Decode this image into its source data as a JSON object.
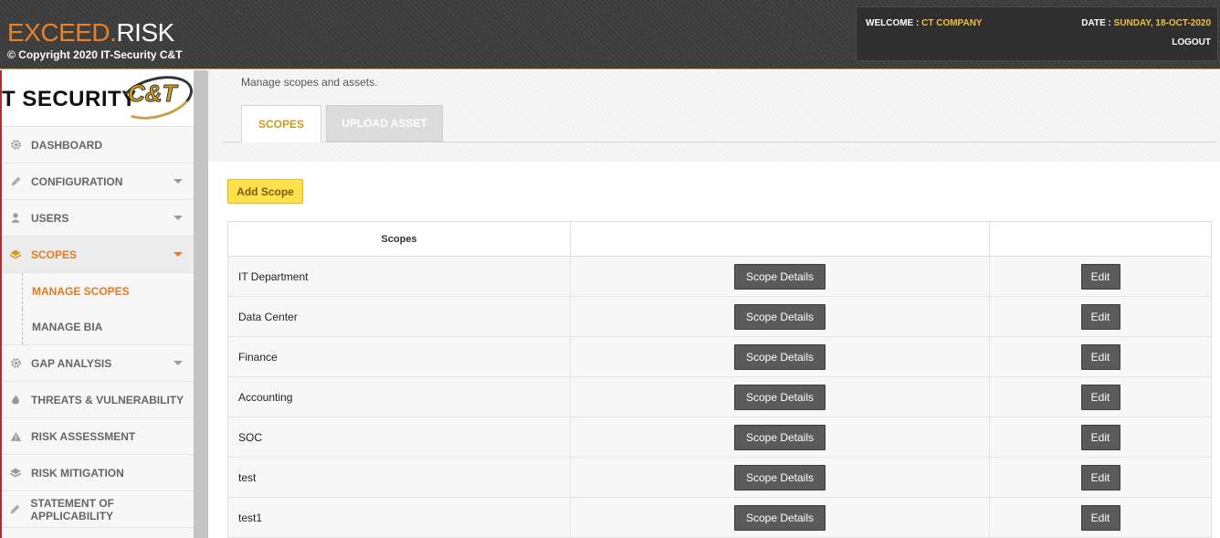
{
  "header": {
    "brand_part1": "EXCEED.",
    "brand_part2": "RISK",
    "copyright": "© Copyright 2020 IT-Security C&T",
    "welcome_label": "WELCOME : ",
    "welcome_value": "CT COMPANY",
    "date_label": "DATE : ",
    "date_value": "SUNDAY, 18-OCT-2020",
    "logout": "LOGOUT"
  },
  "sidebar": {
    "logo_text": "T SECURITY",
    "logo_mark": "C&T",
    "items": [
      {
        "label": "DASHBOARD",
        "icon": "gear-icon"
      },
      {
        "label": "CONFIGURATION",
        "icon": "pencil-icon"
      },
      {
        "label": "USERS",
        "icon": "user-icon"
      },
      {
        "label": "SCOPES",
        "icon": "layers-icon"
      },
      {
        "label": "GAP ANALYSIS",
        "icon": "gear-icon"
      },
      {
        "label": "THREATS & VULNERABILITY",
        "icon": "fire-icon"
      },
      {
        "label": "RISK ASSESSMENT",
        "icon": "warning-icon"
      },
      {
        "label": "RISK MITIGATION",
        "icon": "layers-icon"
      },
      {
        "label": "STATEMENT OF APPLICABILITY",
        "icon": "pencil-icon"
      }
    ],
    "subitems": [
      {
        "label": "MANAGE SCOPES"
      },
      {
        "label": "MANAGE BIA"
      }
    ]
  },
  "main": {
    "subtitle": "Manage scopes and assets.",
    "tabs": [
      {
        "label": "SCOPES"
      },
      {
        "label": "UPLOAD ASSET"
      }
    ],
    "add_button": "Add Scope",
    "table": {
      "headers": [
        "Scopes",
        "",
        ""
      ],
      "details_label": "Scope Details",
      "edit_label": "Edit",
      "rows": [
        {
          "name": "IT Department"
        },
        {
          "name": "Data Center"
        },
        {
          "name": "Finance"
        },
        {
          "name": "Accounting"
        },
        {
          "name": "SOC"
        },
        {
          "name": "test"
        },
        {
          "name": "test1"
        }
      ]
    }
  },
  "colors": {
    "accent_orange": "#e07b20",
    "accent_gold": "#c89c1e",
    "add_button_bg": "#ffe04d",
    "dark_button": "#5a5a5a"
  }
}
